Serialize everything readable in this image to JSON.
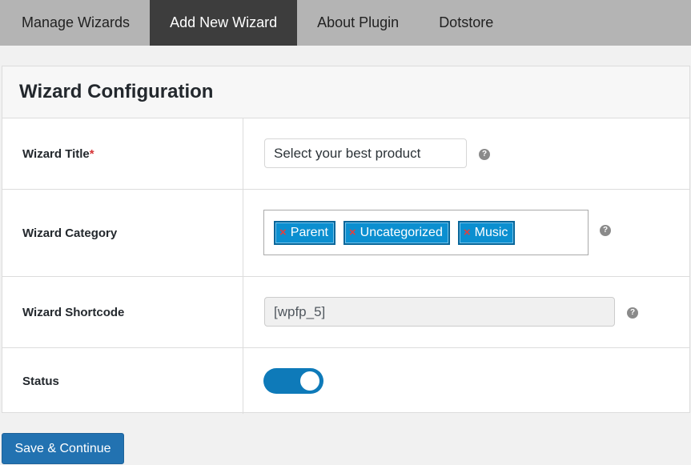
{
  "tabs": [
    {
      "label": "Manage Wizards",
      "active": false
    },
    {
      "label": "Add New Wizard",
      "active": true
    },
    {
      "label": "About Plugin",
      "active": false
    },
    {
      "label": "Dotstore",
      "active": false
    }
  ],
  "panel": {
    "title": "Wizard Configuration",
    "rows": {
      "title": {
        "label": "Wizard Title",
        "required_mark": "*",
        "value": "Select your best product"
      },
      "category": {
        "label": "Wizard Category",
        "chips": [
          "Parent",
          "Uncategorized",
          "Music"
        ],
        "remove_glyph": "×"
      },
      "shortcode": {
        "label": "Wizard Shortcode",
        "value": "[wpfp_5]"
      },
      "status": {
        "label": "Status",
        "enabled": true
      }
    },
    "help_glyph": "?"
  },
  "save_button": {
    "label": "Save & Continue"
  },
  "colors": {
    "tab_active_bg": "#3d3d3d",
    "tab_bar_bg": "#b4b4b4",
    "chip_bg": "#0b8fd0",
    "toggle_on": "#0e7ab9",
    "primary_button": "#2272b1",
    "required": "#d63638"
  },
  "icons": {
    "help": "question-circle-icon",
    "chip_remove": "close-icon"
  }
}
